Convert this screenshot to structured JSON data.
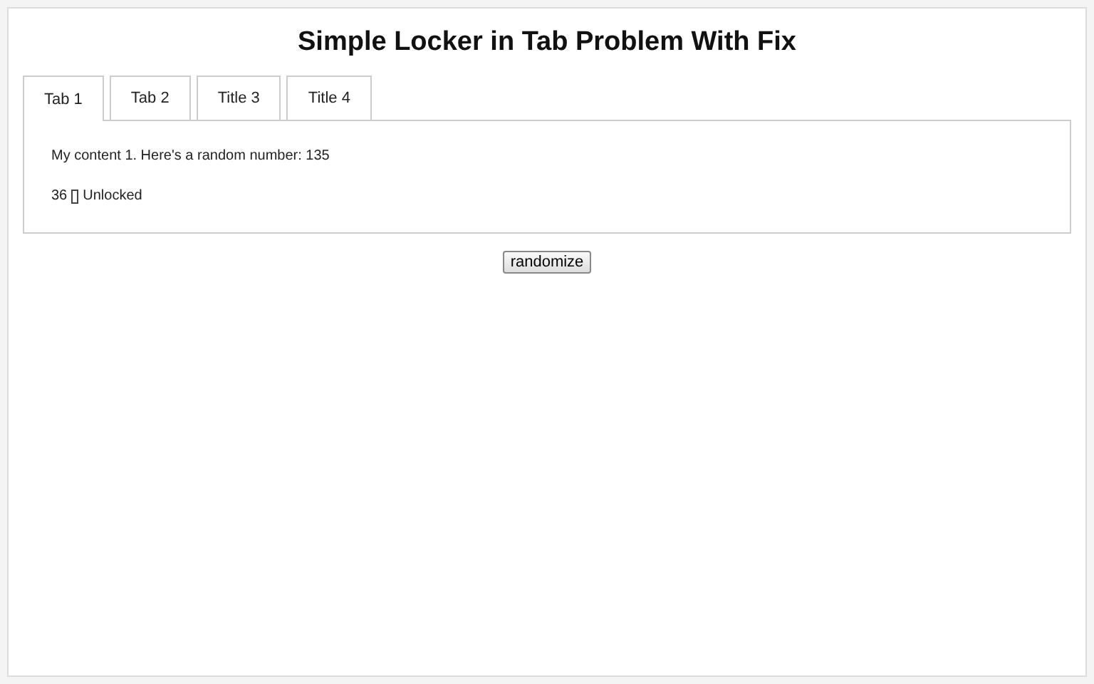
{
  "title": "Simple Locker in Tab Problem With Fix",
  "tabs": [
    {
      "label": "Tab 1",
      "selected": true
    },
    {
      "label": "Tab 2",
      "selected": false
    },
    {
      "label": "Title 3",
      "selected": false
    },
    {
      "label": "Title 4",
      "selected": false
    }
  ],
  "panel": {
    "text": "My content 1. Here's a random number: 135",
    "count": "36",
    "status": "Unlocked"
  },
  "button": "randomize"
}
